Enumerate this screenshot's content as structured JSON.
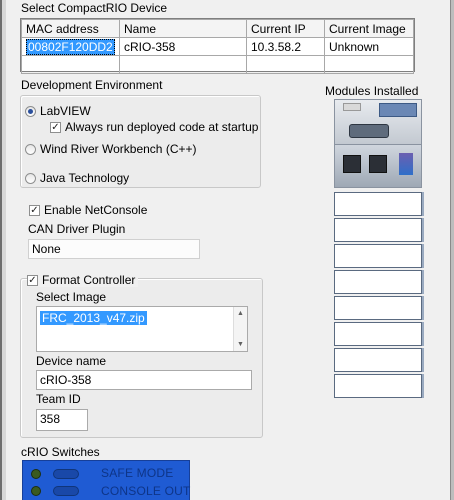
{
  "device_select": {
    "title": "Select CompactRIO Device",
    "columns": [
      "MAC address",
      "Name",
      "Current IP",
      "Current Image"
    ],
    "rows": [
      [
        "00802F120DD2",
        "cRIO-358",
        "10.3.58.2",
        "Unknown"
      ]
    ]
  },
  "dev_env": {
    "title": "Development Environment",
    "labview": "LabVIEW",
    "always_run": "Always run deployed code at startup",
    "wind_river": "Wind River Workbench (C++)",
    "java": "Java Technology",
    "selected": "labview"
  },
  "enable_netconsole": "Enable NetConsole",
  "can_driver": {
    "label": "CAN Driver Plugin",
    "value": "None"
  },
  "format": {
    "label": "Format Controller",
    "select_image_label": "Select Image",
    "image_value": "FRC_2013_v47.zip",
    "device_name_label": "Device name",
    "device_name_value": "cRIO-358",
    "team_id_label": "Team ID",
    "team_id_value": "358"
  },
  "modules": {
    "label": "Modules Installed",
    "slot_count": 8
  },
  "switches": {
    "label": "cRIO Switches",
    "safe_mode": "SAFE MODE",
    "console_out": "CONSOLE OUT"
  },
  "colors": {
    "selection": "#3399ff",
    "switch_panel": "#1f5bd3"
  }
}
